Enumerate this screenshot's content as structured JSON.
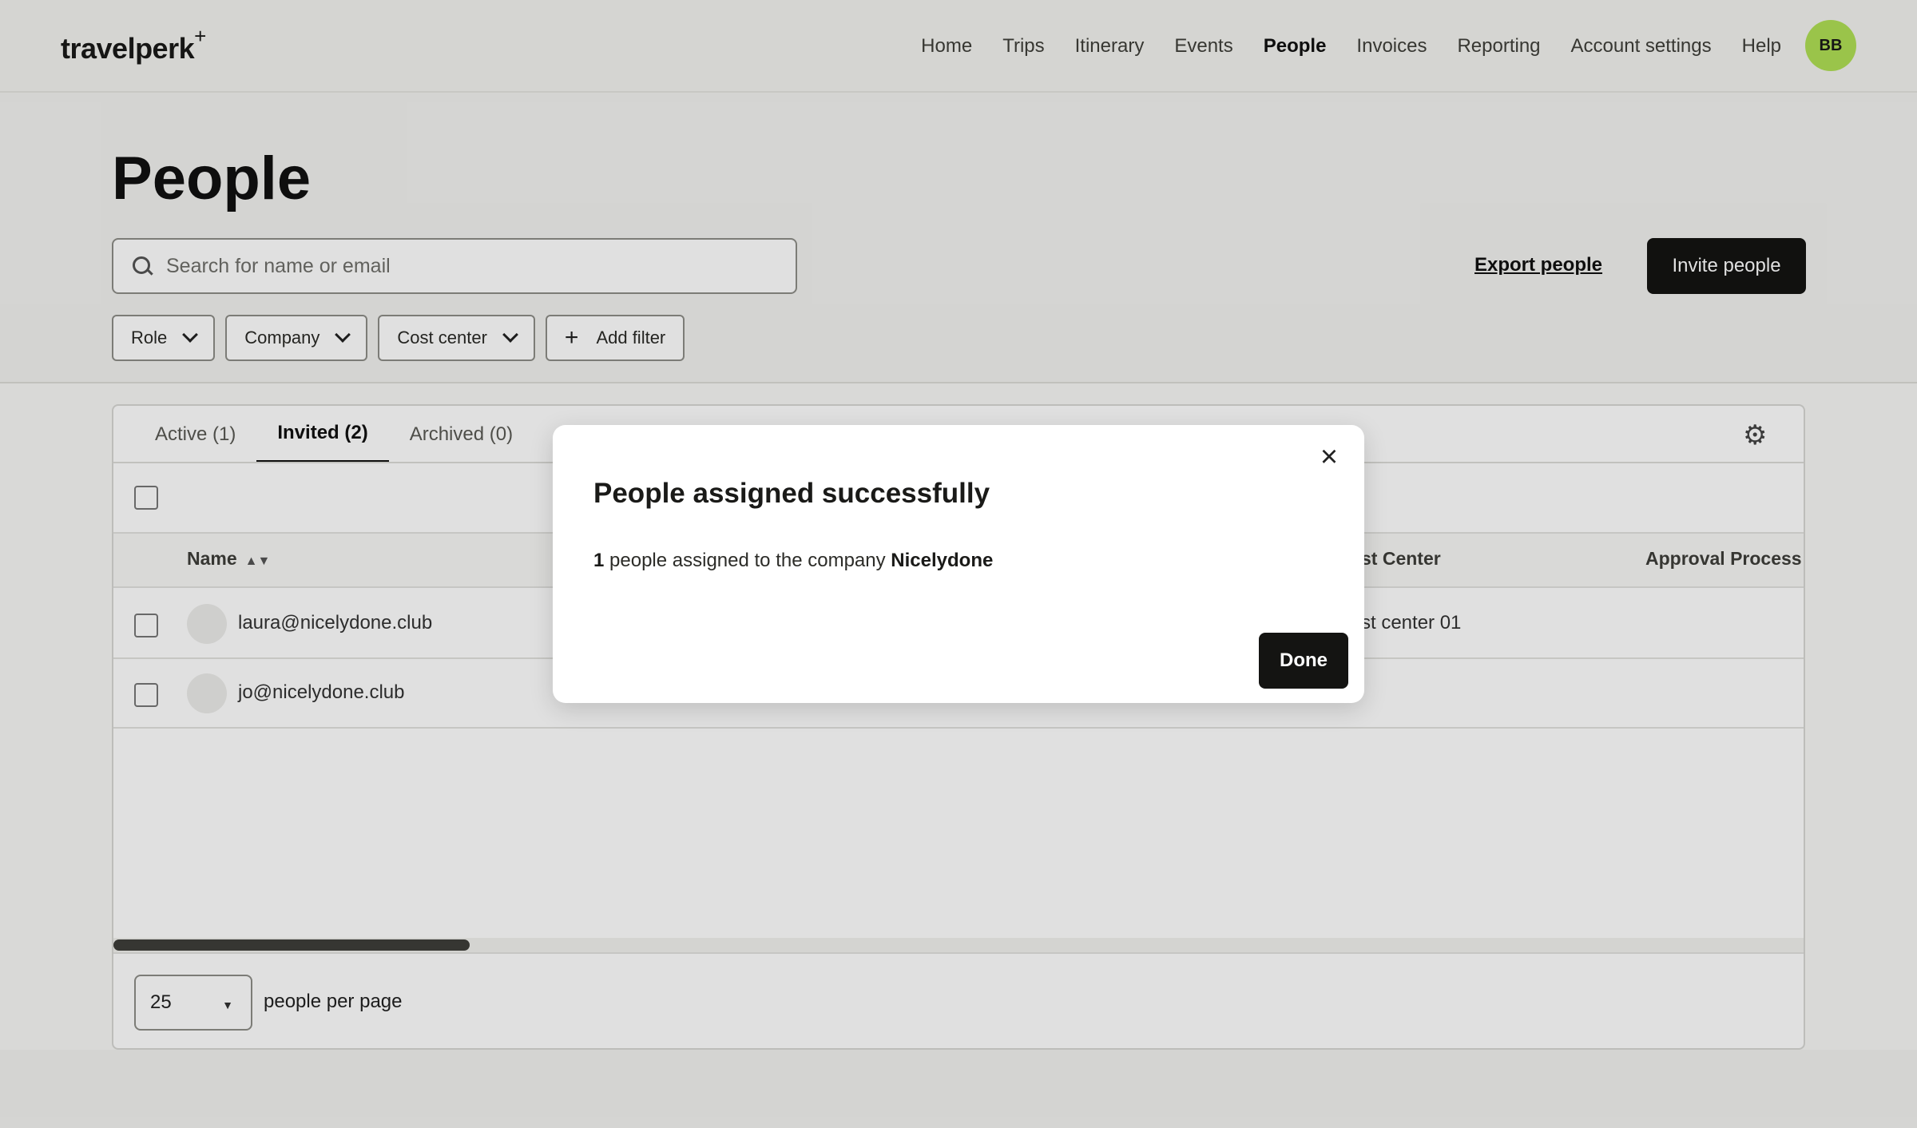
{
  "header": {
    "logo": "travelperk",
    "logo_plus": "+",
    "nav": [
      "Home",
      "Trips",
      "Itinerary",
      "Events",
      "People",
      "Invoices",
      "Reporting",
      "Account settings",
      "Help"
    ],
    "active_nav": "People",
    "avatar_initials": "BB",
    "avatar_color": "#b0e055"
  },
  "page": {
    "title": "People",
    "search_placeholder": "Search for name or email",
    "export_label": "Export people",
    "invite_label": "Invite people",
    "filters": [
      "Role",
      "Company",
      "Cost center"
    ],
    "add_filter_label": "Add filter"
  },
  "tabs": [
    "Active (1)",
    "Invited (2)",
    "Archived (0)"
  ],
  "active_tab": "Invited (2)",
  "table": {
    "columns": {
      "name": "Name",
      "cost_center": "st Center",
      "approval": "Approval Process"
    },
    "rows": [
      {
        "email": "laura@nicelydone.club",
        "cost_center": "st center 01"
      },
      {
        "email": "jo@nicelydone.club",
        "cost_center": ""
      }
    ]
  },
  "pagination": {
    "per_page_value": "25",
    "per_page_label": "people per page"
  },
  "modal": {
    "title": "People assigned successfully",
    "count": "1",
    "message": "people assigned to the company",
    "company": "Nicelydone",
    "done_label": "Done"
  },
  "colors": {
    "primary_button": "#141412",
    "accent_avatar": "#b0e055"
  }
}
